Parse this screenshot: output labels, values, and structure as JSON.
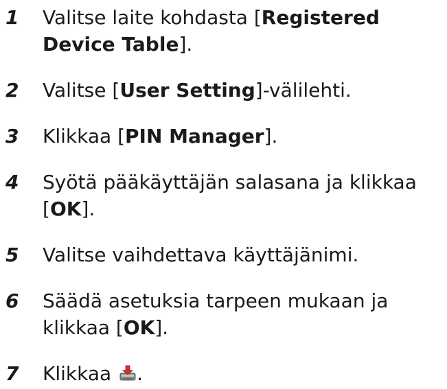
{
  "steps": [
    {
      "number": "1",
      "before": "Valitse laite kohdasta [",
      "bold": "Registered Device Table",
      "after": "]."
    },
    {
      "number": "2",
      "before": "Valitse [",
      "bold": "User Setting",
      "after": "]-välilehti."
    },
    {
      "number": "3",
      "before": "Klikkaa [",
      "bold": "PIN Manager",
      "after": "]."
    },
    {
      "number": "4",
      "before": "Syötä pääkäyttäjän salasana ja klikkaa [",
      "bold": "OK",
      "after": "]."
    },
    {
      "number": "5",
      "text": "Valitse vaihdettava käyttäjänimi."
    },
    {
      "number": "6",
      "before": "Säädä asetuksia tarpeen mukaan ja klikkaa [",
      "bold": "OK",
      "after": "]."
    },
    {
      "number": "7",
      "before": "Klikkaa ",
      "icon": "save-to-device-icon",
      "after": "."
    }
  ]
}
